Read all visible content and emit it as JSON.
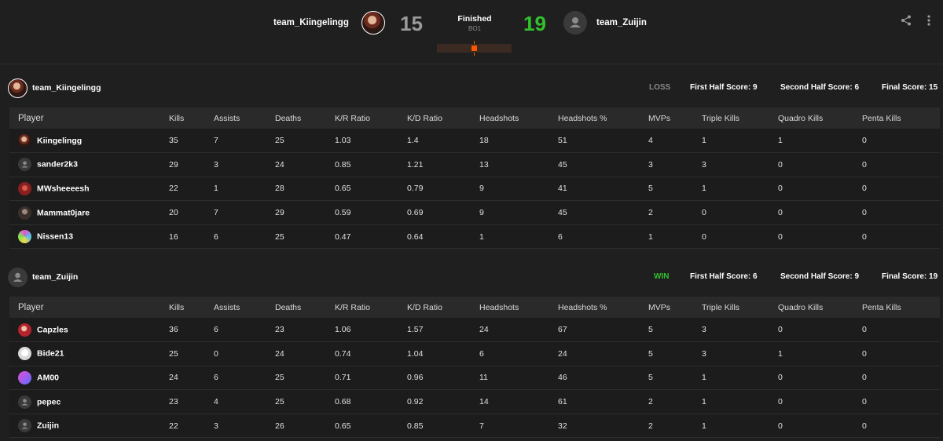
{
  "match": {
    "left_team": "team_Kiingelingg",
    "right_team": "team_Zuijin",
    "left_score": "15",
    "right_score": "19",
    "status": "Finished",
    "best_of": "BO1",
    "colors": {
      "accent": "#ff5500",
      "win": "#32c12c",
      "loss": "#9a9a9a"
    }
  },
  "columns": [
    "Player",
    "Kills",
    "Assists",
    "Deaths",
    "K/R Ratio",
    "K/D Ratio",
    "Headshots",
    "Headshots %",
    "MVPs",
    "Triple Kills",
    "Quadro Kills",
    "Penta Kills"
  ],
  "teams": [
    {
      "name": "team_Kiingelingg",
      "result": "LOSS",
      "first_half": "First Half Score: 9",
      "second_half": "Second Half Score: 6",
      "final": "Final Score: 15",
      "players": [
        {
          "name": "Kiingelingg",
          "avatar": "portrait-avatar",
          "stats": [
            "35",
            "7",
            "25",
            "1.03",
            "1.4",
            "18",
            "51",
            "4",
            "1",
            "1",
            "0"
          ]
        },
        {
          "name": "sander2k3",
          "avatar": "default-user-avatar",
          "stats": [
            "29",
            "3",
            "24",
            "0.85",
            "1.21",
            "13",
            "45",
            "3",
            "3",
            "0",
            "0"
          ]
        },
        {
          "name": "MWsheeeesh",
          "avatar": "red-avatar",
          "stats": [
            "22",
            "1",
            "28",
            "0.65",
            "0.79",
            "9",
            "41",
            "5",
            "1",
            "0",
            "0"
          ]
        },
        {
          "name": "Mammat0jare",
          "avatar": "dark-portrait-avatar",
          "stats": [
            "20",
            "7",
            "29",
            "0.59",
            "0.69",
            "9",
            "45",
            "2",
            "0",
            "0",
            "0"
          ]
        },
        {
          "name": "Nissen13",
          "avatar": "colorful-avatar",
          "stats": [
            "16",
            "6",
            "25",
            "0.47",
            "0.64",
            "1",
            "6",
            "1",
            "0",
            "0",
            "0"
          ]
        }
      ]
    },
    {
      "name": "team_Zuijin",
      "result": "WIN",
      "first_half": "First Half Score: 6",
      "second_half": "Second Half Score: 9",
      "final": "Final Score: 19",
      "players": [
        {
          "name": "Capzles",
          "avatar": "red-portrait-avatar",
          "stats": [
            "36",
            "6",
            "23",
            "1.06",
            "1.57",
            "24",
            "67",
            "5",
            "3",
            "0",
            "0"
          ]
        },
        {
          "name": "Bide21",
          "avatar": "white-figure-avatar",
          "stats": [
            "25",
            "0",
            "24",
            "0.74",
            "1.04",
            "6",
            "24",
            "5",
            "3",
            "1",
            "0"
          ]
        },
        {
          "name": "AM00",
          "avatar": "pink-blue-avatar",
          "stats": [
            "24",
            "6",
            "25",
            "0.71",
            "0.96",
            "11",
            "46",
            "5",
            "1",
            "0",
            "0"
          ]
        },
        {
          "name": "pepec",
          "avatar": "default-user-avatar",
          "stats": [
            "23",
            "4",
            "25",
            "0.68",
            "0.92",
            "14",
            "61",
            "2",
            "1",
            "0",
            "0"
          ]
        },
        {
          "name": "Zuijin",
          "avatar": "default-user-avatar",
          "stats": [
            "22",
            "3",
            "26",
            "0.65",
            "0.85",
            "7",
            "32",
            "2",
            "1",
            "0",
            "0"
          ]
        }
      ]
    }
  ]
}
